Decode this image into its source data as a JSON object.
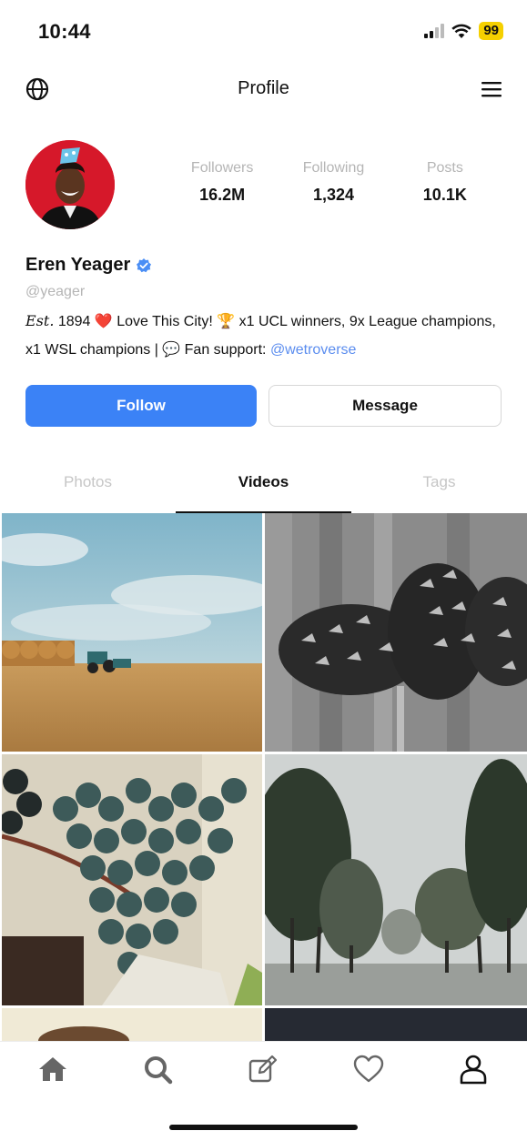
{
  "status_bar": {
    "time": "10:44",
    "battery": "99"
  },
  "nav": {
    "title": "Profile",
    "left_icon": "globe-icon",
    "right_icon": "hamburger-menu-icon"
  },
  "profile": {
    "name": "Eren Yeager",
    "verified": true,
    "handle": "@yeager",
    "stats": [
      {
        "label": "Followers",
        "value": "16.2M"
      },
      {
        "label": "Following",
        "value": "1,324"
      },
      {
        "label": "Posts",
        "value": "10.1K"
      }
    ],
    "bio": {
      "est": "Est.",
      "line1": " 1894 ❤️ Love This City! 🏆 x1 UCL winners, 9x League champions, x1 WSL champions | 💬 Fan support: ",
      "link": "@wetroverse"
    }
  },
  "actions": {
    "follow": "Follow",
    "message": "Message"
  },
  "tabs": [
    {
      "label": "Photos",
      "active": false
    },
    {
      "label": "Videos",
      "active": true
    },
    {
      "label": "Tags",
      "active": false
    }
  ],
  "grid": [
    {
      "name": "farm-field-tile",
      "subject": "hay bales and tractor in field"
    },
    {
      "name": "pinecone-tile",
      "subject": "black and white pinecones"
    },
    {
      "name": "grapes-tile",
      "subject": "dark grapes on vine"
    },
    {
      "name": "trees-tile",
      "subject": "misty row of trees"
    },
    {
      "name": "partial-tile-left",
      "subject": "partially visible image"
    },
    {
      "name": "partial-tile-right",
      "subject": "partially visible dark image"
    }
  ],
  "tab_bar": [
    {
      "icon": "home-icon",
      "active": false
    },
    {
      "icon": "search-icon",
      "active": false
    },
    {
      "icon": "compose-icon",
      "active": false
    },
    {
      "icon": "heart-icon",
      "active": false
    },
    {
      "icon": "profile-icon",
      "active": true
    }
  ],
  "colors": {
    "accent": "#3b82f6",
    "link": "#5b8def",
    "muted": "#b5b5b5",
    "battery": "#f5d000",
    "avatar_bg": "#d6182a"
  }
}
